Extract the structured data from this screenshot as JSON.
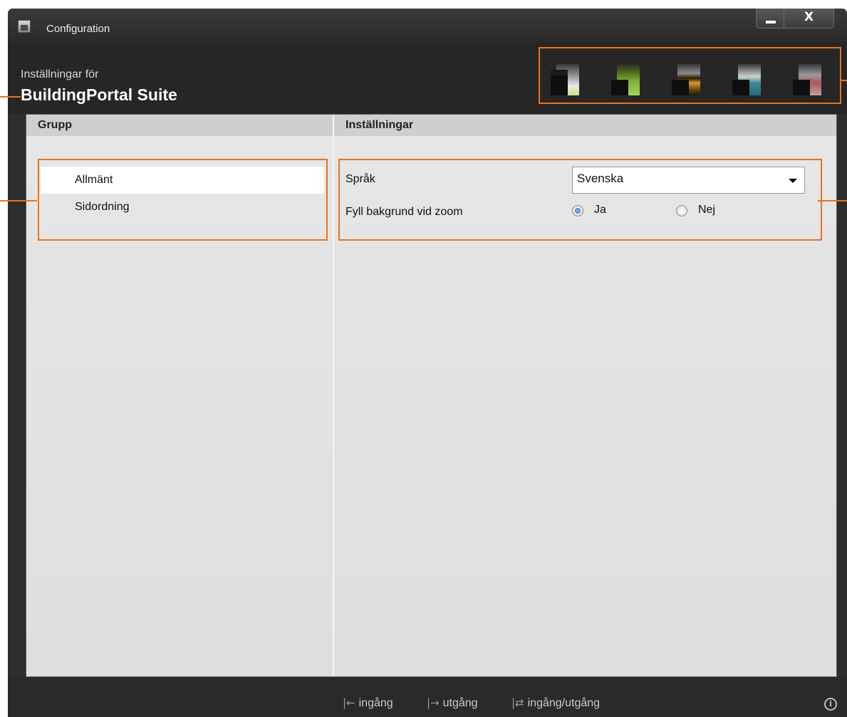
{
  "window": {
    "title": "Configuration",
    "close_label": "X"
  },
  "header": {
    "subtitle": "Inställningar för",
    "app_name": "BuildingPortal Suite",
    "themes": [
      {
        "name": "theme-light",
        "color": "#c8e07a"
      },
      {
        "name": "theme-green",
        "color": "#7fb03a"
      },
      {
        "name": "theme-gold",
        "color": "#d59a2a"
      },
      {
        "name": "theme-teal",
        "color": "#3a8a9a"
      },
      {
        "name": "theme-red",
        "color": "#a85a5a"
      }
    ]
  },
  "groups": {
    "heading": "Grupp",
    "items": [
      "Allmänt",
      "Sidordning"
    ],
    "selected": "Allmänt"
  },
  "settings": {
    "heading": "Inställningar",
    "language_label": "Språk",
    "language_value": "Svenska",
    "zoom_label": "Fyll bakgrund vid zoom",
    "zoom_options": [
      "Ja",
      "Nej"
    ],
    "zoom_selected": "Ja"
  },
  "footer": {
    "legend": [
      {
        "icon": "entry-arrow-icon",
        "label": "ingång"
      },
      {
        "icon": "exit-arrow-icon",
        "label": "utgång"
      },
      {
        "icon": "entry-exit-arrows-icon",
        "label": "ingång/utgång"
      }
    ]
  },
  "colors": {
    "accent": "#e8731c",
    "selected_radio": "#2367b4"
  }
}
